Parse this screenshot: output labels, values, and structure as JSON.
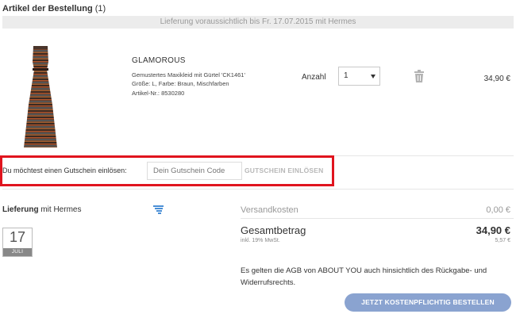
{
  "order": {
    "section_title_bold": "Artikel der Bestellung",
    "section_title_count": "(1)",
    "delivery_estimate": "Lieferung voraussichtlich bis Fr. 17.07.2015 mit Hermes"
  },
  "item": {
    "brand": "GLAMOROUS",
    "description": "Gemustertes Maxikleid mit Gürtel 'CK1461'",
    "size_color": "Größe: L, Farbe: Braun, Mischfarben",
    "article_no": "Artikel-Nr.: 8530280",
    "quantity_label": "Anzahl",
    "quantity_value": "1",
    "price": "34,90 €",
    "image_icon": "dress-product-image",
    "delete_icon": "trash-icon"
  },
  "voucher": {
    "label": "Du möchtest einen Gutschein einlösen:",
    "placeholder": "Dein Gutschein Code",
    "button_label": "GUTSCHEIN EINLÖSEN",
    "highlight_color": "#e0141e"
  },
  "delivery": {
    "title_bold": "Lieferung",
    "title_rest": "mit Hermes",
    "day": "17",
    "month": "JULI",
    "icon": "truck-icon"
  },
  "summary": {
    "shipping_label": "Versandkosten",
    "shipping_value": "0,00 €",
    "total_label": "Gesamtbetrag",
    "total_value": "34,90 €",
    "vat_label": "inkl. 19% MwSt.",
    "vat_value": "5,57 €"
  },
  "terms": {
    "prefix": "Es gelten die",
    "agb_link": "AGB",
    "middle": "von",
    "shop_link": "ABOUT YOU",
    "suffix": "auch hinsichtlich des",
    "withdrawal_link": "Rückgabe- und Widerrufsrechts",
    "end": "."
  },
  "checkout": {
    "button_label": "JETZT KOSTENPFLICHTIG BESTELLEN",
    "button_color": "#8aa3d0"
  }
}
